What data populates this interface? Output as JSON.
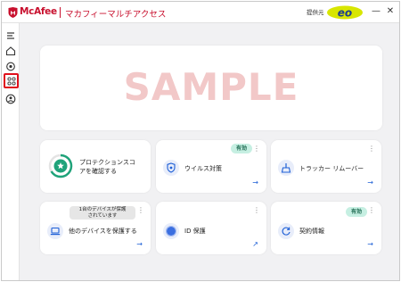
{
  "titlebar": {
    "brand": "McAfee",
    "app_name": "マカフィーマルチアクセス",
    "provider_label": "提供元",
    "provider_logo_text": "eo",
    "minimize": "—",
    "close": "✕"
  },
  "sidebar": {
    "items": [
      {
        "icon": "menu-icon"
      },
      {
        "icon": "home-icon"
      },
      {
        "icon": "protection-icon"
      },
      {
        "icon": "apps-grid-icon",
        "highlighted": true
      },
      {
        "icon": "account-icon"
      }
    ]
  },
  "hero": {
    "watermark": "SAMPLE"
  },
  "cards": {
    "protection": {
      "label_line1": "プロテクションスコ",
      "label_line2": "アを確認する",
      "icon": "shield-star-icon"
    },
    "virus": {
      "label": "ウイルス対策",
      "badge": "有効",
      "icon": "virus-shield-icon"
    },
    "tracker": {
      "label": "トラッカー リムーバー",
      "icon": "broom-icon"
    },
    "devices": {
      "label": "他のデバイスを保護する",
      "tooltip_line1": "1台のデバイスが保護",
      "tooltip_line2": "されています",
      "icon": "laptop-icon"
    },
    "id": {
      "label": "ID 保護",
      "icon": "id-protection-icon"
    },
    "contract": {
      "label": "契約情報",
      "badge": "有効",
      "icon": "refresh-icon"
    }
  },
  "colors": {
    "brand_red": "#c8102e",
    "accent_blue": "#1d5fd6",
    "badge_green": "#c6efe2",
    "highlight_red": "#e0101c"
  }
}
